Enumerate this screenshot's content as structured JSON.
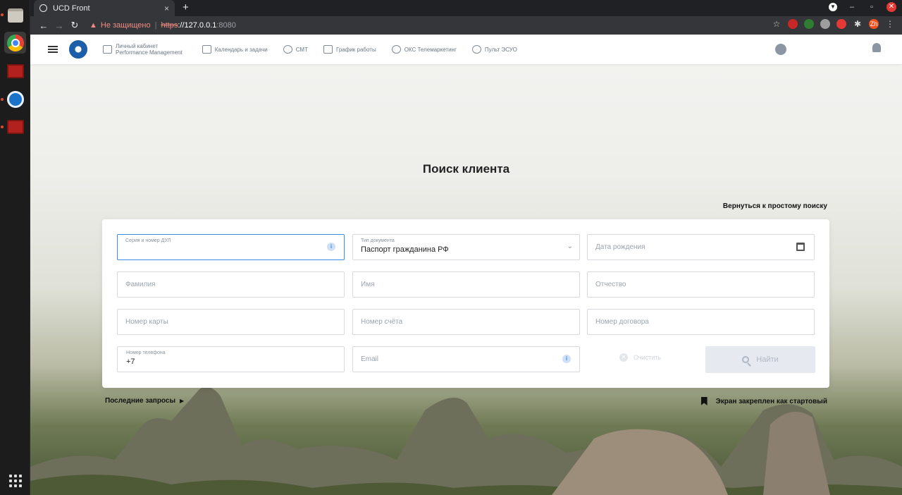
{
  "browser": {
    "tab_title": "UCD Front",
    "tab_close": "×",
    "new_tab": "+",
    "security_text": "Не защищено",
    "url_scheme": "https",
    "url_host": "://127.0.0.1",
    "url_port": ":8080",
    "profile_initials": "Zh"
  },
  "header": {
    "nav": [
      {
        "line1": "Личный кабинет",
        "line2": "Performance Management"
      },
      {
        "label": "Календарь и задачи"
      },
      {
        "label": "СМТ"
      },
      {
        "label": "График работы"
      },
      {
        "label": "ОКС Телемаркетинг"
      },
      {
        "label": "Пульт ЭСУО"
      }
    ]
  },
  "page": {
    "title": "Поиск клиента",
    "back_link": "Вернуться к простому поиску"
  },
  "form": {
    "doc_number_label": "Серия и номер ДУЛ",
    "doc_type_label": "Тип документа",
    "doc_type_value": "Паспорт гражданина РФ",
    "birth_date_placeholder": "Дата рождения",
    "last_name_placeholder": "Фамилия",
    "first_name_placeholder": "Имя",
    "middle_name_placeholder": "Отчество",
    "card_number_placeholder": "Номер карты",
    "account_number_placeholder": "Номер счёта",
    "contract_number_placeholder": "Номер договора",
    "phone_label": "Номер телефона",
    "phone_value": "+7",
    "email_placeholder": "Email",
    "clear_label": "Очистить",
    "find_label": "Найти"
  },
  "footer": {
    "recent_label": "Последние запросы",
    "pinned_label": "Экран закреплен как стартовый"
  }
}
